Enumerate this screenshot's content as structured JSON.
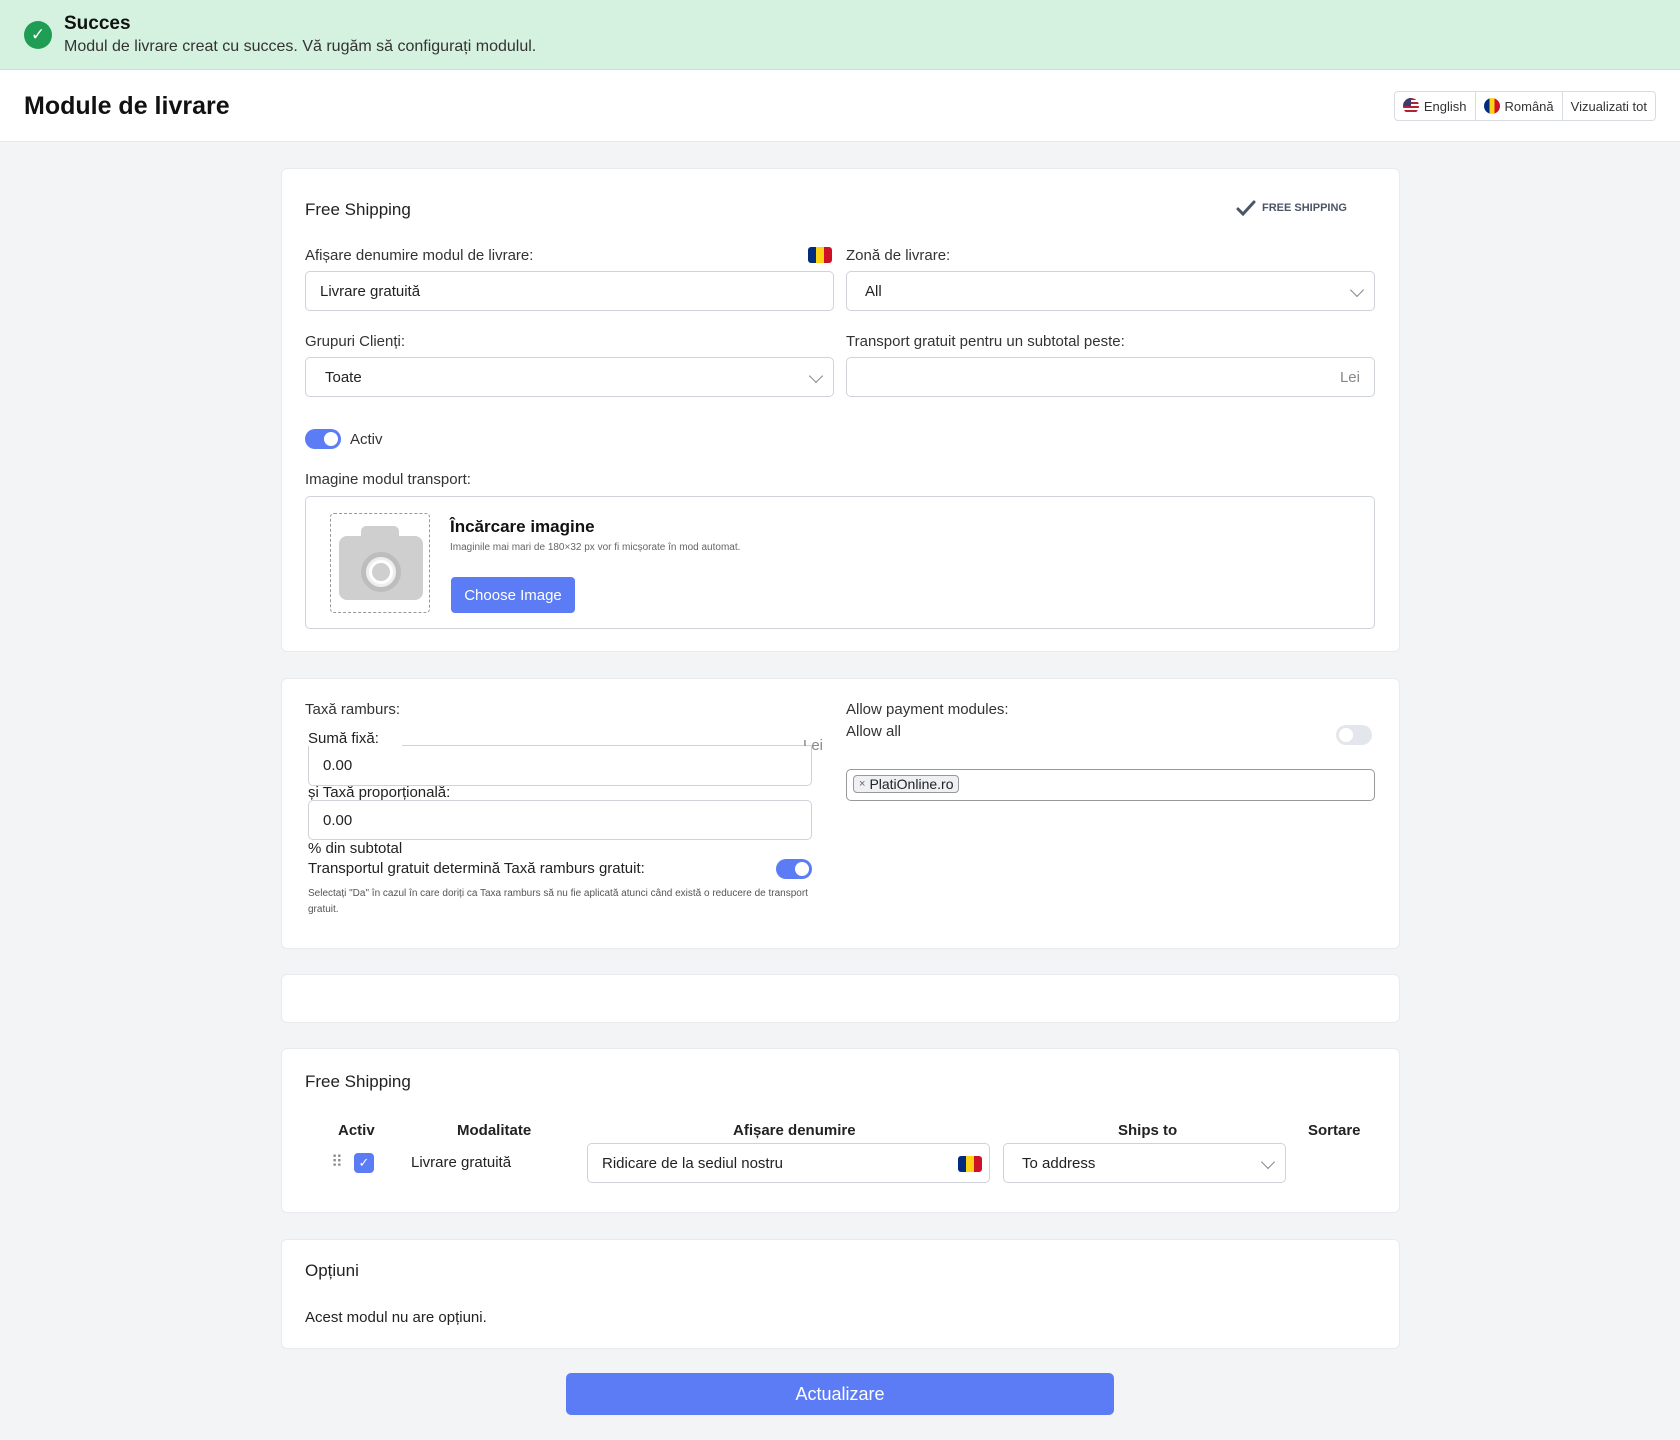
{
  "alert": {
    "title": "Succes",
    "message": "Modul de livrare creat cu succes. Vă rugăm să configurați modulul."
  },
  "header": {
    "title": "Module de livrare",
    "languages": [
      "English",
      "Română"
    ],
    "view_all": "Vizualizati tot"
  },
  "module": {
    "title": "Free Shipping",
    "badge": "FREE SHIPPING",
    "name_label": "Afișare denumire modul de livrare:",
    "name_value": "Livrare gratuită",
    "zone_label": "Zonă de livrare:",
    "zone_value": "All",
    "groups_label": "Grupuri Clienți:",
    "groups_value": "Toate",
    "free_threshold_label": "Transport gratuit pentru un subtotal peste:",
    "free_threshold_value": "",
    "currency": "Lei",
    "active_label": "Activ",
    "active": true,
    "image_label": "Imagine modul transport:",
    "upload_title": "Încărcare imagine",
    "upload_hint": "Imaginile mai mari de 180×32 px vor fi micșorate în mod automat.",
    "choose_image": "Choose Image"
  },
  "cod": {
    "title": "Taxă ramburs:",
    "fixed_label": "Sumă fixă:",
    "fixed_value": "0.00",
    "currency": "Lei",
    "proportional_label": "și Taxă proporțională:",
    "proportional_value": "0.00",
    "proportional_suffix": "% din subtotal",
    "free_cod_label": "Transportul gratuit determină Taxă ramburs gratuit:",
    "free_cod_enabled": true,
    "free_cod_hint": "Selectați \"Da\" în cazul în care doriți ca Taxa ramburs să nu fie aplicată atunci când există o reducere de transport gratuit.",
    "payment_label": "Allow payment modules:",
    "allow_all_label": "Allow all",
    "allow_all_enabled": false,
    "payment_tags": [
      "PlatiOnline.ro"
    ]
  },
  "methods": {
    "title": "Free Shipping",
    "columns": [
      "Activ",
      "Modalitate",
      "Afișare denumire",
      "Ships to",
      "Sortare"
    ],
    "rows": [
      {
        "active": true,
        "method": "Livrare gratuită",
        "display_name": "Ridicare de la sediul nostru",
        "ships_to": "To address"
      }
    ]
  },
  "options": {
    "title": "Opțiuni",
    "message": "Acest modul nu are opțiuni."
  },
  "submit_label": "Actualizare",
  "colors": {
    "accent": "#5b7cf5",
    "success_bg": "#d5f2e0",
    "success_icon": "#1f9d55"
  }
}
